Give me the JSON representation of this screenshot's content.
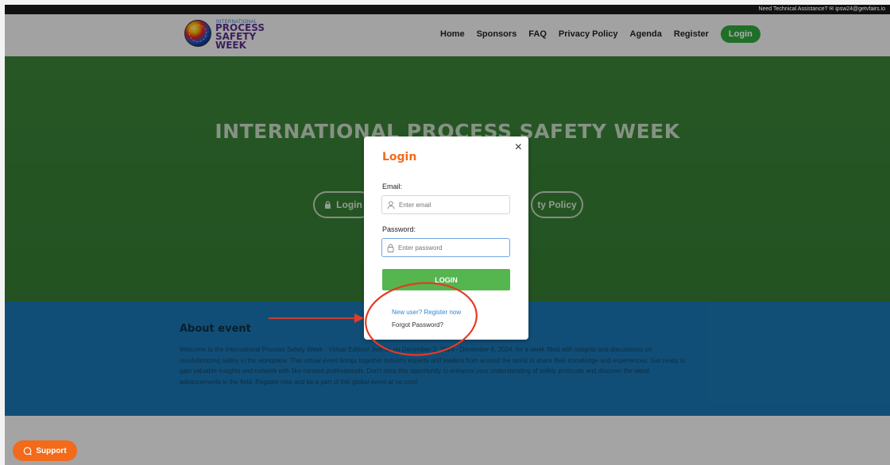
{
  "topbar": {
    "assistance_text": "Need Technical Assistance? ✉ ipsw24@getvfairs.io"
  },
  "logo": {
    "small_text": "INTERNATIONAL",
    "line1": "PROCESS",
    "line2": "SAFETY",
    "line3": "WEEK"
  },
  "nav": {
    "items": [
      {
        "label": "Home"
      },
      {
        "label": "Sponsors"
      },
      {
        "label": "FAQ"
      },
      {
        "label": "Privacy Policy"
      },
      {
        "label": "Agenda"
      },
      {
        "label": "Register"
      }
    ],
    "login_label": "Login"
  },
  "hero": {
    "title": "INTERNATIONAL PROCESS SAFETY WEEK",
    "login_button": "Login",
    "policy_button": "ty Policy"
  },
  "about": {
    "heading": "About event",
    "text": "Welcome to the International Process Safety Week - Virtual Edition! Join us on December 2, 2024 - December 6, 2024, for a week filled with insights and discussions on revolutionizing safety in the workplace. This virtual event brings together industry experts and leaders from around the world to share their knowledge and experiences. Get ready to gain valuable insights and network with like-minded professionals. Don't miss this opportunity to enhance your understanding of safety protocols and discover the latest advancements in the field. Register now and be a part of this global event at no cost!"
  },
  "modal": {
    "title": "Login",
    "close": "×",
    "email_label": "Email:",
    "email_placeholder": "Enter email",
    "password_label": "Password:",
    "password_placeholder": "Enter password",
    "submit_label": "LOGIN",
    "register_link": "New user? Register now",
    "forgot_link": "Forgot Password?"
  },
  "support": {
    "label": "Support"
  },
  "colors": {
    "accent_orange": "#f26a1a",
    "hero_green": "#3d8b3a",
    "about_blue": "#1a74b0",
    "login_green": "#55b54e",
    "annotation_red": "#e53a24"
  }
}
